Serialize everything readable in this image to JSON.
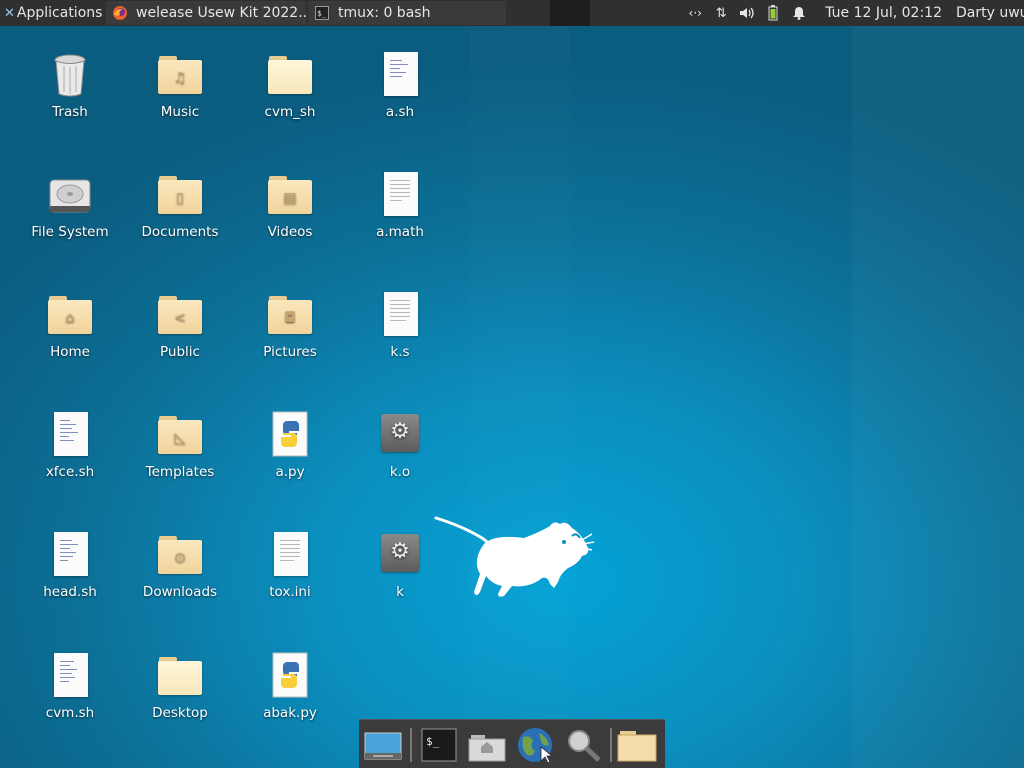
{
  "panel": {
    "applications_label": "Applications",
    "tasks": [
      {
        "label": "welease Usew Kit 2022...",
        "icon": "firefox-icon"
      },
      {
        "label": "tmux: 0 bash",
        "icon": "terminal-icon"
      }
    ],
    "clock": "Tue 12 Jul, 02:12",
    "user": "Darty uwu"
  },
  "desktop": {
    "icons": [
      {
        "label": "Trash",
        "type": "trash"
      },
      {
        "label": "Music",
        "type": "folder-music"
      },
      {
        "label": "cvm_sh",
        "type": "folder-plain"
      },
      {
        "label": "a.sh",
        "type": "script"
      },
      {
        "label": "File System",
        "type": "drive"
      },
      {
        "label": "Documents",
        "type": "folder-documents"
      },
      {
        "label": "Videos",
        "type": "folder-videos"
      },
      {
        "label": "a.math",
        "type": "text"
      },
      {
        "label": "Home",
        "type": "folder-home"
      },
      {
        "label": "Public",
        "type": "folder-public"
      },
      {
        "label": "Pictures",
        "type": "folder-pictures"
      },
      {
        "label": "k.s",
        "type": "text"
      },
      {
        "label": "xfce.sh",
        "type": "script"
      },
      {
        "label": "Templates",
        "type": "folder-templates"
      },
      {
        "label": "a.py",
        "type": "python"
      },
      {
        "label": "k.o",
        "type": "binary"
      },
      {
        "label": "head.sh",
        "type": "script"
      },
      {
        "label": "Downloads",
        "type": "folder-downloads"
      },
      {
        "label": "tox.ini",
        "type": "text"
      },
      {
        "label": "k",
        "type": "binary"
      },
      {
        "label": "cvm.sh",
        "type": "script"
      },
      {
        "label": "Desktop",
        "type": "folder-plain"
      },
      {
        "label": "abak.py",
        "type": "python"
      }
    ]
  },
  "dock": {
    "items": [
      "show-desktop-icon",
      "terminal-icon",
      "home-folder-icon",
      "web-browser-icon",
      "app-finder-icon",
      "file-manager-icon"
    ]
  },
  "colors": {
    "panel_bg": "#303030",
    "desktop_bg": "#0b8fbf",
    "dock_bg": "#3b3b3b",
    "folder": "#f0d39a"
  }
}
